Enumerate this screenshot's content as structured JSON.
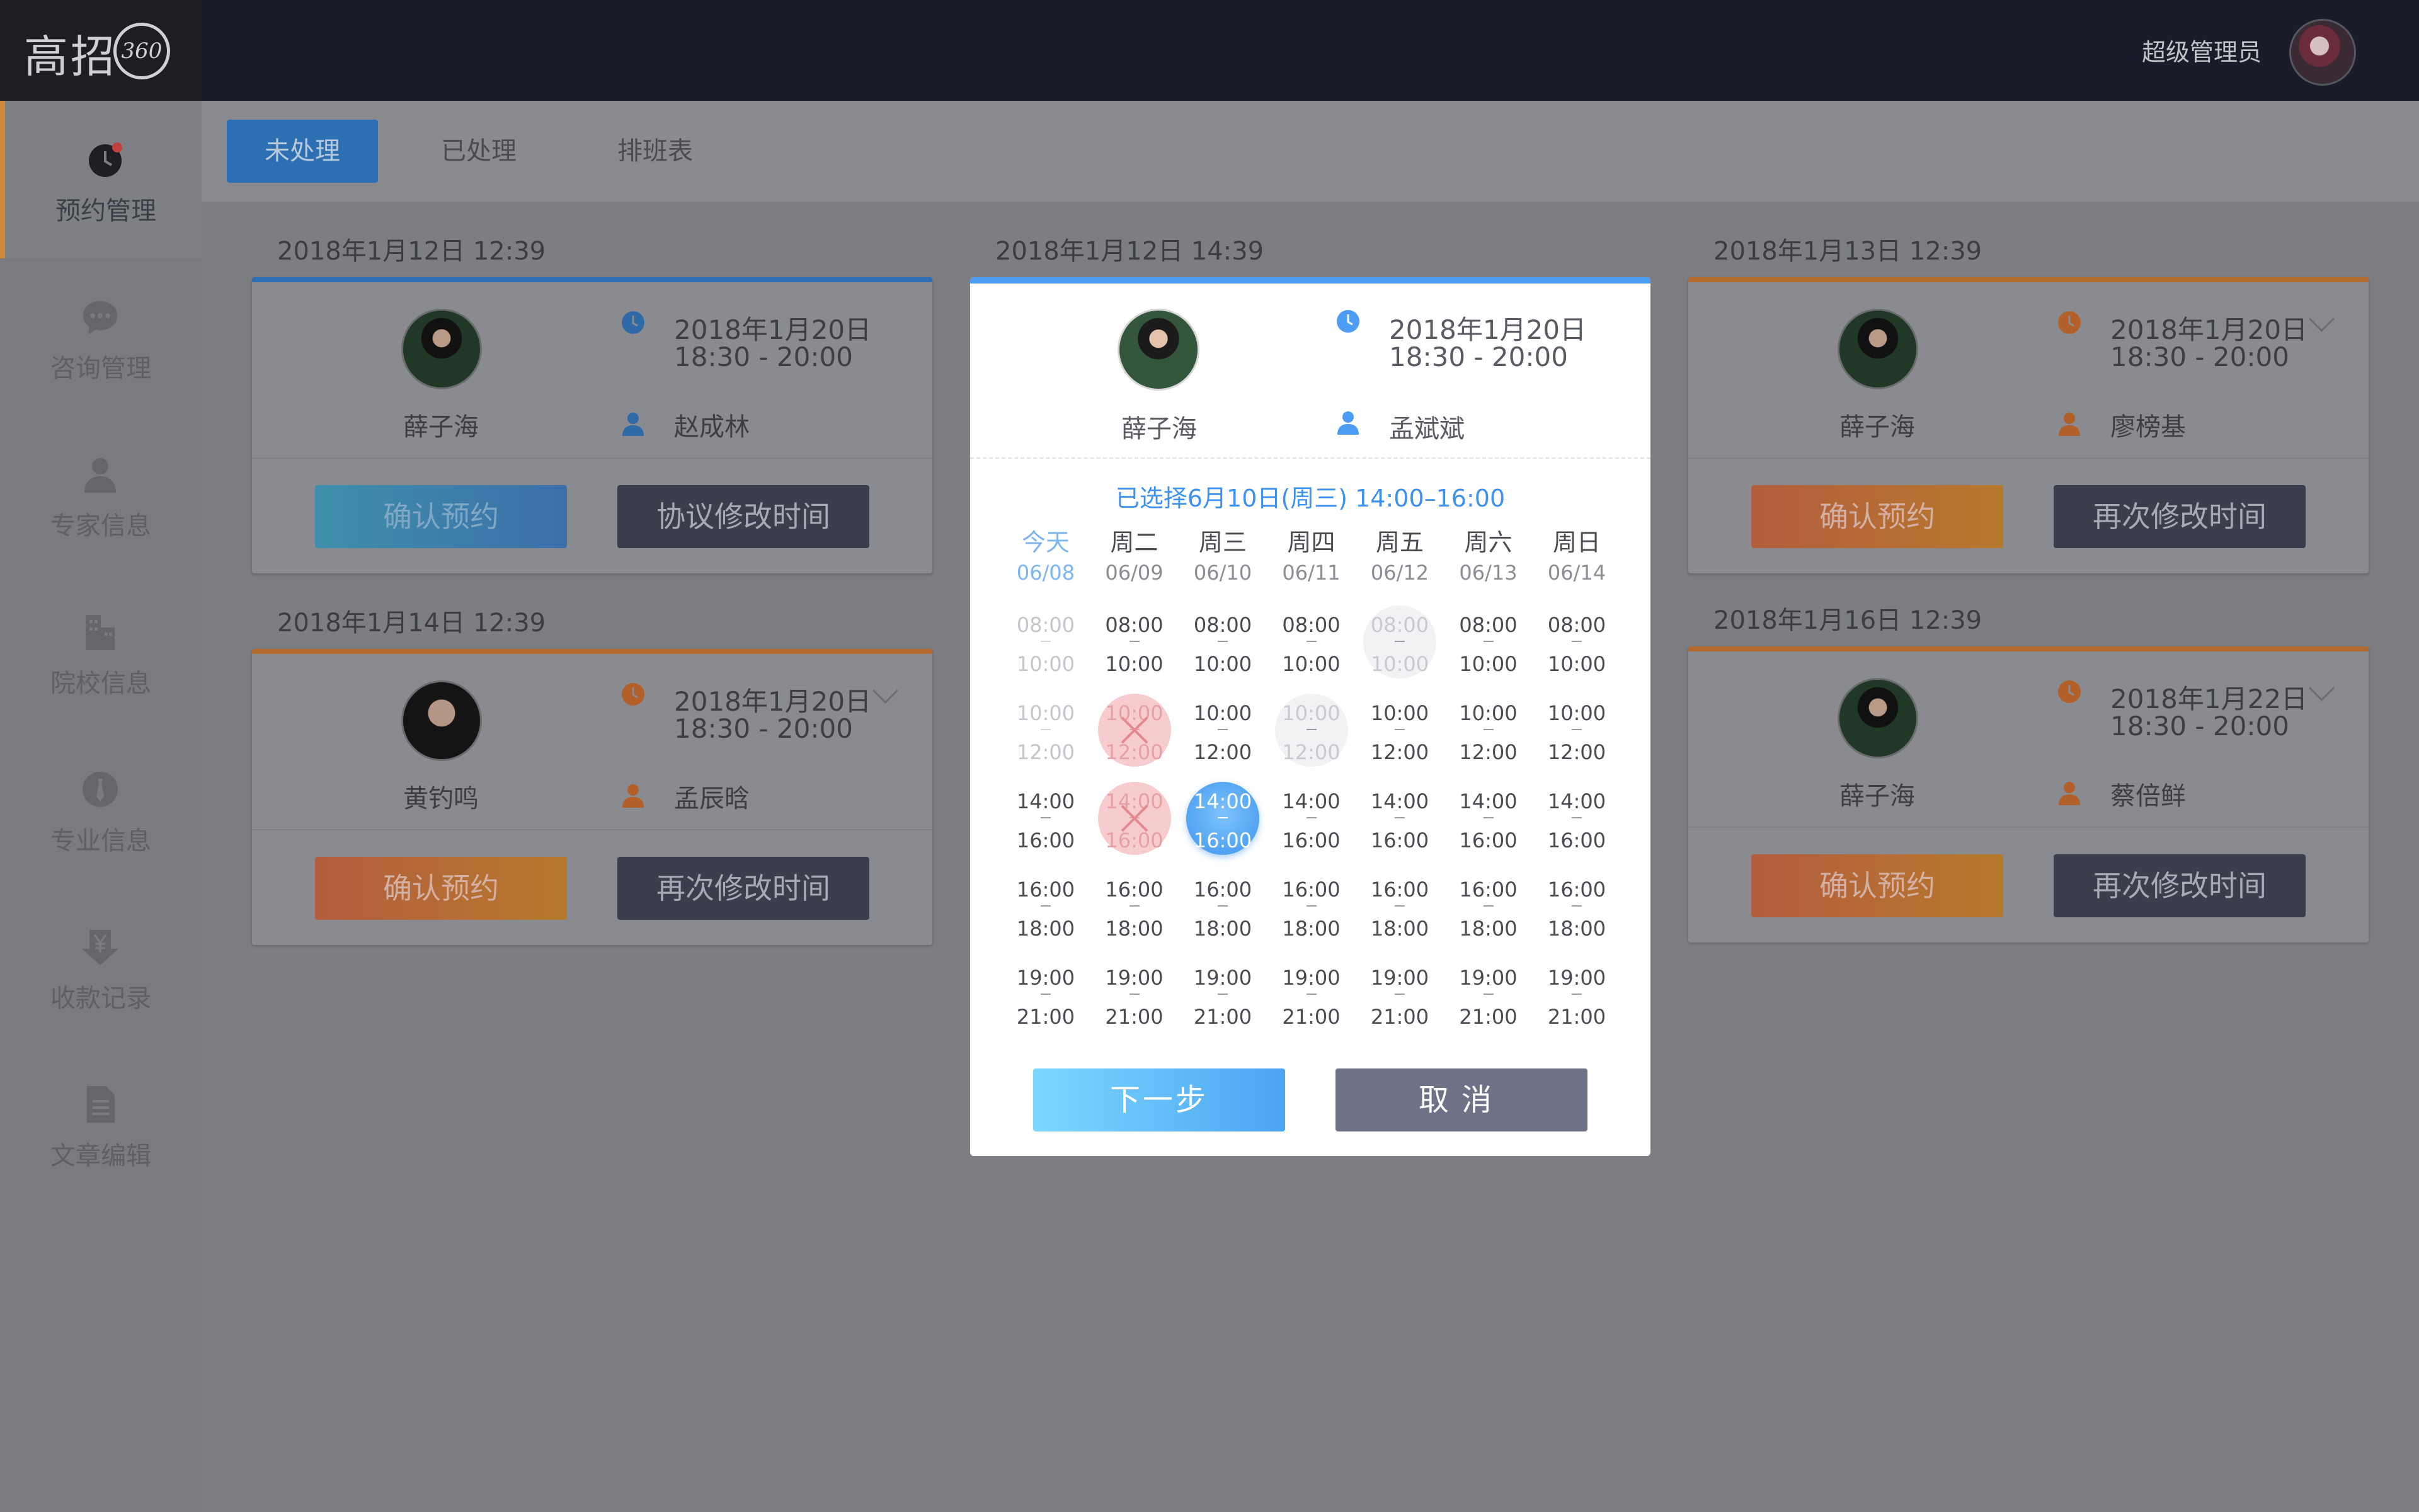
{
  "app": {
    "logo_text": "高招",
    "logo_badge": "360",
    "admin_name": "超级管理员"
  },
  "sidebar": {
    "items": [
      {
        "label": "预约管理",
        "icon": "clock-icon",
        "active": true
      },
      {
        "label": "咨询管理",
        "icon": "chat-bubble-icon"
      },
      {
        "label": "专家信息",
        "icon": "person-icon"
      },
      {
        "label": "院校信息",
        "icon": "building-icon"
      },
      {
        "label": "专业信息",
        "icon": "tie-icon"
      },
      {
        "label": "收款记录",
        "icon": "yuan-download-icon"
      },
      {
        "label": "文章编辑",
        "icon": "document-icon"
      }
    ]
  },
  "tabs": [
    {
      "label": "未处理",
      "active": true
    },
    {
      "label": "已处理"
    },
    {
      "label": "排班表"
    }
  ],
  "cards": [
    {
      "created": "2018年1月12日  12:39",
      "expert": "薛子海",
      "date": "2018年1月20日",
      "time": "18:30 - 20:00",
      "user": "赵成林",
      "btn1": "确认预约",
      "btn2": "协议修改时间",
      "accent": "#2f6fb3"
    },
    {
      "created": "2018年1月13日  12:39",
      "expert": "薛子海",
      "date": "2018年1月20日",
      "time": "18:30 - 20:00",
      "user": "廖榜基",
      "btn1": "确认预约",
      "btn2": "再次修改时间",
      "accent": "#b36a2e"
    },
    {
      "created": "2018年1月14日  12:39",
      "expert": "黄钓鸣",
      "date": "2018年1月20日",
      "time": "18:30 - 20:00",
      "user": "孟辰晗",
      "btn1": "确认预约",
      "btn2": "再次修改时间",
      "accent": "#b36a2e"
    },
    {
      "created": "2018年1月16日  12:39",
      "expert": "薛子海",
      "date": "2018年1月22日",
      "time": "18:30 - 20:00",
      "user": "蔡倍鲜",
      "btn1": "确认预约",
      "btn2": "再次修改时间",
      "accent": "#b36a2e"
    }
  ],
  "modal": {
    "created": "2018年1月12日  14:39",
    "expert": "薛子海",
    "date": "2018年1月20日",
    "time": "18:30 - 20:00",
    "user": "孟斌斌",
    "selected_text": "已选择6月10日(周三) 14:00–16:00",
    "days": [
      {
        "name": "今天",
        "date": "06/08"
      },
      {
        "name": "周二",
        "date": "06/09"
      },
      {
        "name": "周三",
        "date": "06/10"
      },
      {
        "name": "周四",
        "date": "06/11"
      },
      {
        "name": "周五",
        "date": "06/12"
      },
      {
        "name": "周六",
        "date": "06/13"
      },
      {
        "name": "周日",
        "date": "06/14"
      }
    ],
    "slots": [
      {
        "start": "08:00",
        "end": "10:00"
      },
      {
        "start": "10:00",
        "end": "12:00"
      },
      {
        "start": "14:00",
        "end": "16:00"
      },
      {
        "start": "16:00",
        "end": "18:00"
      },
      {
        "start": "19:00",
        "end": "21:00"
      }
    ],
    "slot_states": [
      [
        "dim",
        "normal",
        "normal",
        "normal",
        "gray",
        "normal",
        "normal"
      ],
      [
        "dim",
        "booked",
        "normal",
        "gray",
        "normal",
        "normal",
        "normal"
      ],
      [
        "normal",
        "booked",
        "selected",
        "normal",
        "normal",
        "normal",
        "normal"
      ],
      [
        "normal",
        "normal",
        "normal",
        "normal",
        "normal",
        "normal",
        "normal"
      ],
      [
        "normal",
        "normal",
        "normal",
        "normal",
        "normal",
        "normal",
        "normal"
      ]
    ],
    "next_label": "下一步",
    "cancel_label": "取消"
  },
  "colors": {
    "accent_blue": "#4d9cf3",
    "selected_slot": "#3d95ee",
    "booked_slot": "#f6cccf",
    "orange": "#e7833f",
    "dark_button": "#3b3e4c"
  }
}
